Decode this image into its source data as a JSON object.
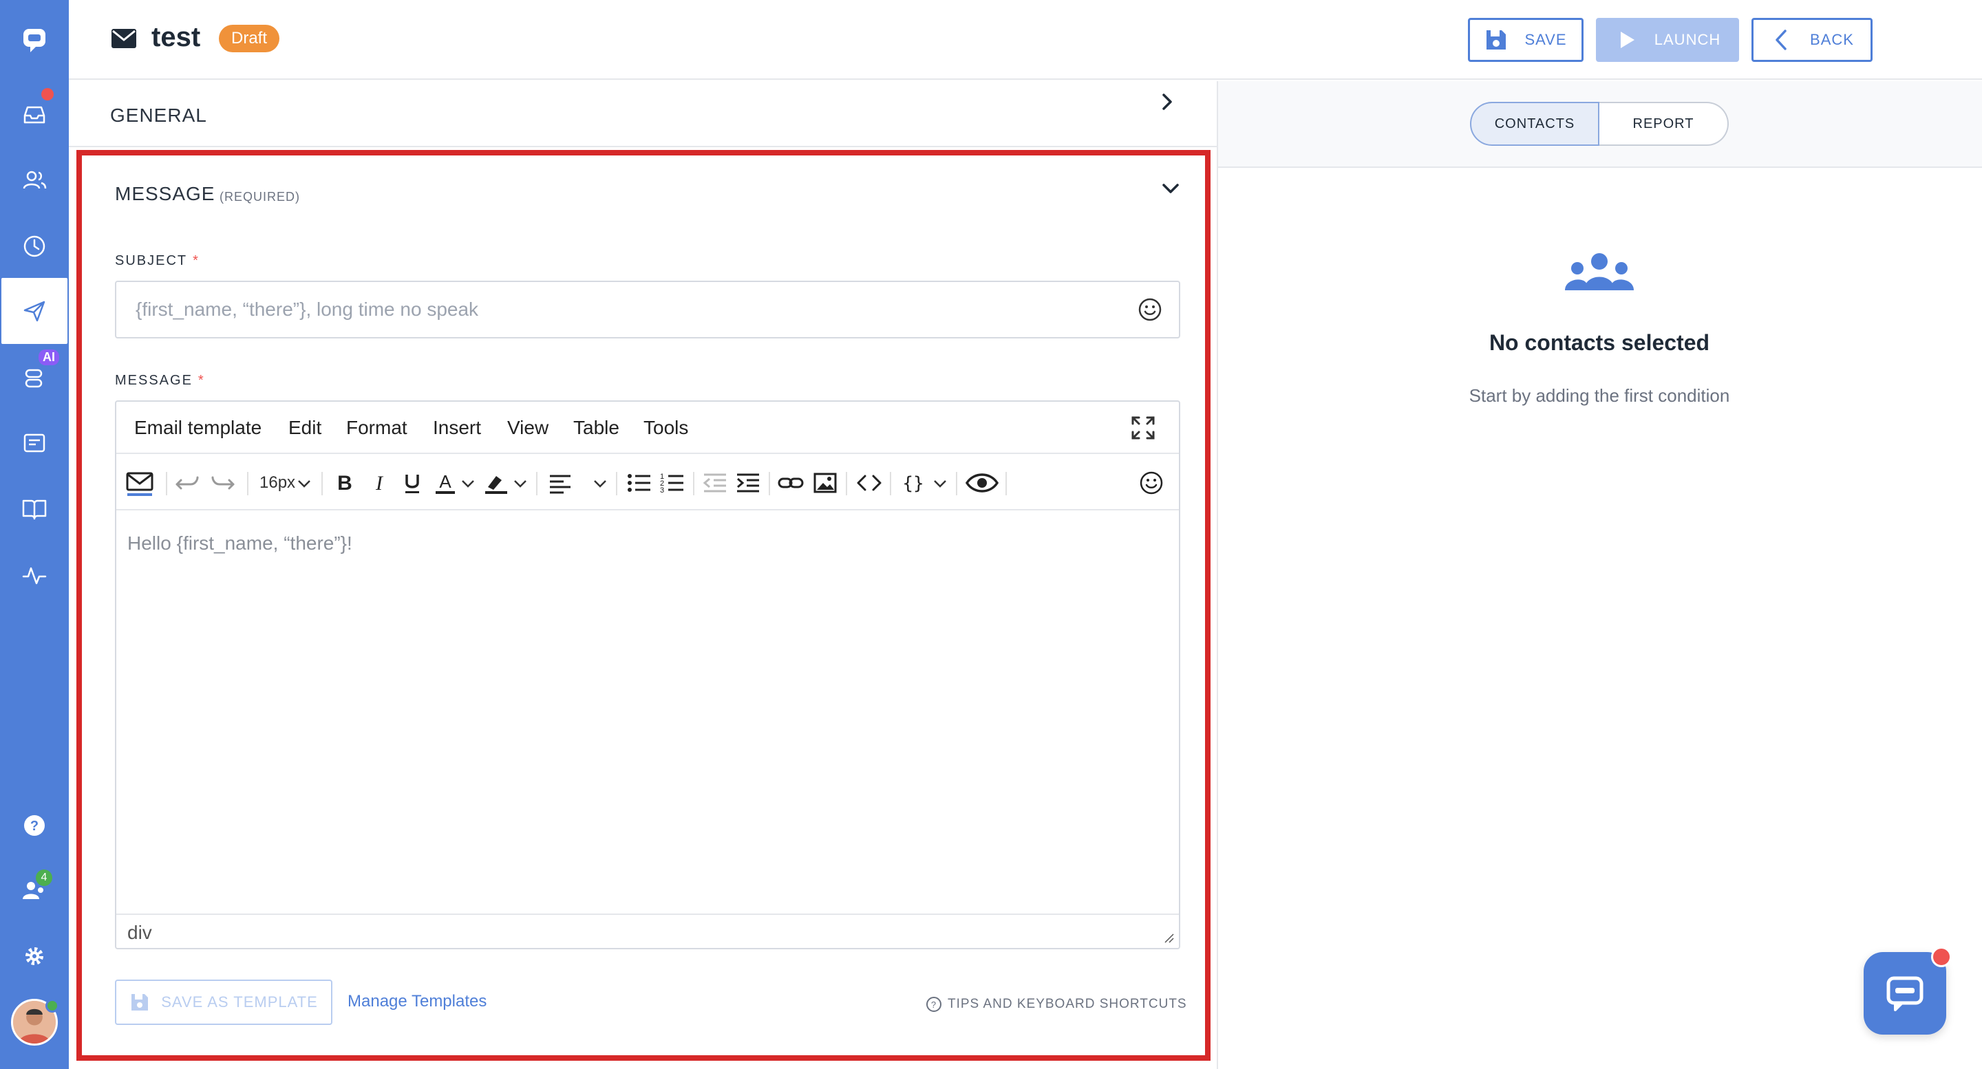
{
  "header": {
    "title": "test",
    "status_badge": "Draft",
    "save_label": "SAVE",
    "launch_label": "LAUNCH",
    "back_label": "BACK"
  },
  "sidebar": {
    "items": [
      {
        "name": "inbox"
      },
      {
        "name": "contacts"
      },
      {
        "name": "history"
      },
      {
        "name": "campaigns",
        "active": true
      },
      {
        "name": "ai-bot",
        "badge": "AI"
      },
      {
        "name": "inbox-widget"
      },
      {
        "name": "knowledge-base"
      },
      {
        "name": "analytics"
      }
    ],
    "bottom": {
      "help": "help",
      "team_badge": "4",
      "settings": "settings"
    }
  },
  "general": {
    "title": "GENERAL"
  },
  "message_section": {
    "title": "MESSAGE",
    "required_label": "(REQUIRED)",
    "subject_label": "SUBJECT",
    "subject_placeholder": "{first_name, “there”}, long time no speak",
    "message_label": "MESSAGE",
    "required_star": "*",
    "editor": {
      "menus": [
        "Email template",
        "Edit",
        "Format",
        "Insert",
        "View",
        "Table",
        "Tools"
      ],
      "font_size": "16px",
      "body_text": "Hello {first_name, “there”}!",
      "status_path": "div"
    },
    "save_template_label": "SAVE AS TEMPLATE",
    "manage_templates_label": "Manage Templates",
    "tips_label": "TIPS AND KEYBOARD SHORTCUTS"
  },
  "right_panel": {
    "tabs": [
      "CONTACTS",
      "REPORT"
    ],
    "active_tab": "CONTACTS",
    "empty_title": "No contacts selected",
    "empty_subtitle": "Start by adding the first condition"
  },
  "colors": {
    "brand": "#4f7fd8",
    "draft": "#f0923a",
    "highlight_border": "#d62828"
  }
}
